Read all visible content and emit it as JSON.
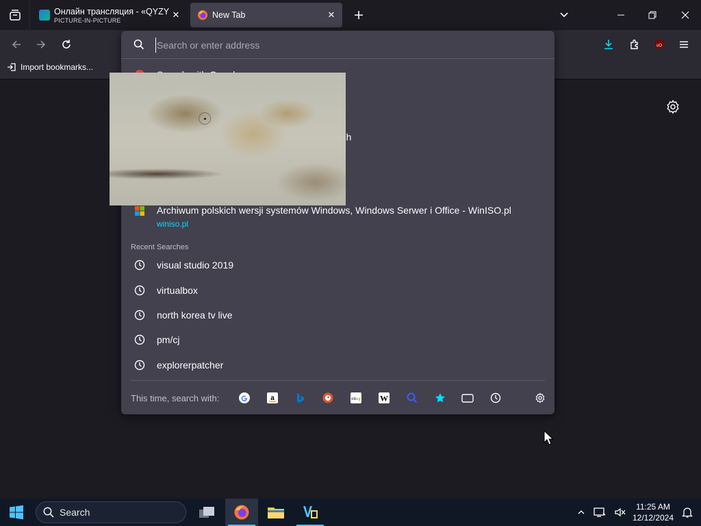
{
  "tabs": [
    {
      "title": "Онлайн трансляция - «QYZYL",
      "subtitle": "PICTURE-IN-PICTURE",
      "active": false
    },
    {
      "title": "New Tab",
      "active": true
    }
  ],
  "bookmarks": {
    "import_label": "Import bookmarks..."
  },
  "urlbar": {
    "placeholder": "Search or enter address"
  },
  "results": [
    {
      "title": "Search with Google",
      "icon": "google-icon"
    },
    {
      "title": "atch",
      "icon": ""
    },
    {
      "title": "Archiwum polskich wersji systemów Windows, Windows Serwer i Office - WinISO.pl",
      "url": "winiso.pl",
      "icon": "windows-logo-icon"
    }
  ],
  "recent_searches": {
    "label": "Recent Searches",
    "items": [
      "visual studio 2019",
      "virtualbox",
      "north korea tv live",
      "pm/cj",
      "explorerpatcher"
    ]
  },
  "oneoff": {
    "label": "This time, search with:",
    "engines": [
      "google",
      "amazon",
      "bing",
      "duckduckgo",
      "ebay",
      "wikipedia",
      "search-shortcut",
      "bookmarks",
      "tabs",
      "history"
    ]
  },
  "taskbar": {
    "search_label": "Search",
    "time": "11:25 AM",
    "date": "12/12/2024"
  },
  "colors": {
    "accent": "#00ddff",
    "panel": "#42414d",
    "toolbar": "#2b2a33",
    "background": "#1c1b22",
    "taskbar": "#101826"
  }
}
